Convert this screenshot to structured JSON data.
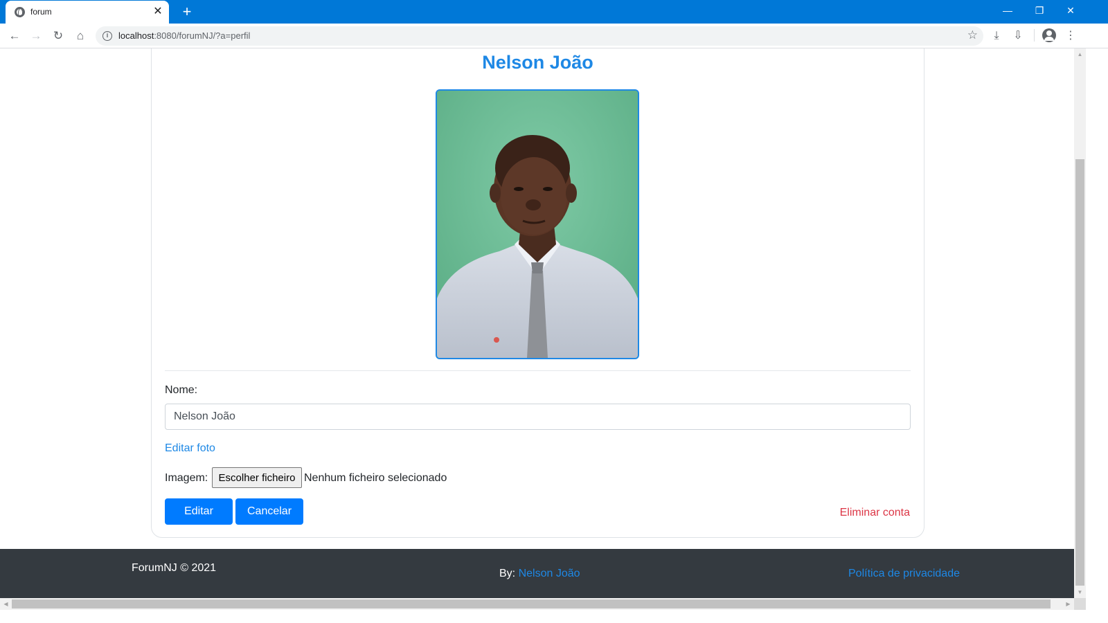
{
  "browser": {
    "tab_title": "forum",
    "tab_close": "✕",
    "new_tab": "+",
    "url_host": "localhost",
    "url_rest": ":8080/forumNJ/?a=perfil",
    "window": {
      "minimize": "—",
      "restore": "❐",
      "close": "✕"
    },
    "nav": {
      "back": "←",
      "forward": "→",
      "reload": "↻",
      "home": "⌂"
    },
    "icons": {
      "star": "☆",
      "downloads": "⤓",
      "download_tray": "⇩",
      "menu": "⋮",
      "info": "i"
    }
  },
  "profile": {
    "name_heading": "Nelson João",
    "photo_alt": "Nelson João",
    "name_label": "Nome:",
    "name_value": "Nelson João",
    "edit_photo_link": "Editar foto",
    "image_label": "Imagem:",
    "file_button": "Escolher ficheiro",
    "file_status": "Nenhum ficheiro selecionado",
    "edit_button": "Editar",
    "cancel_button": "Cancelar",
    "delete_account_link": "Eliminar conta"
  },
  "footer": {
    "copyright": "ForumNJ © 2021",
    "by_label": "By:",
    "by_name": "Nelson João",
    "privacy_link": "Política de privacidade"
  },
  "colors": {
    "chrome_blue": "#0078d7",
    "heading_blue": "#1e88e5",
    "primary_button": "#007bff",
    "danger": "#dc3545",
    "footer_bg": "#343a40"
  }
}
